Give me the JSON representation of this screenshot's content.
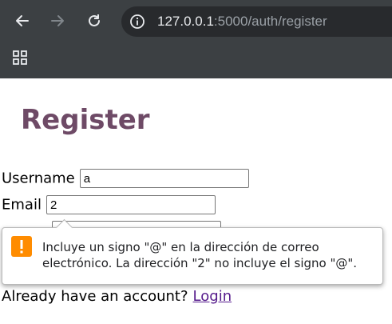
{
  "browser": {
    "url_host": "127.0.0.1",
    "url_rest": ":5000/auth/register",
    "icons": [
      "back-icon",
      "forward-icon",
      "reload-icon",
      "site-info-icon",
      "apps-icon"
    ]
  },
  "page": {
    "title": "Register",
    "username_label": "Username",
    "username_value": "a",
    "email_label": "Email",
    "email_value": "2",
    "footer_text": "Already have an account?",
    "login_link": "Login"
  },
  "validation": {
    "message": "Incluye un signo \"@\" en la dirección de correo electrónico. La dirección \"2\" no incluye el signo \"@\".",
    "icon": "warning-icon",
    "icon_color": "#ff8c00"
  },
  "colors": {
    "title": "#6e4a66",
    "link": "#551a8b",
    "chrome": "#3c4043"
  }
}
